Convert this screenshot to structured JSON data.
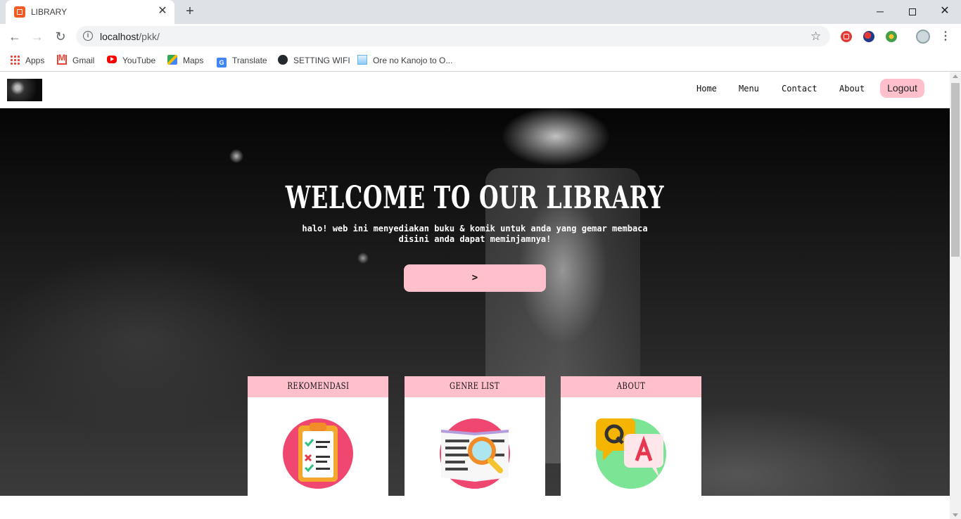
{
  "browser": {
    "tab_title": "LIBRARY",
    "tab_close": "✕",
    "new_tab": "+",
    "url_host": "localhost",
    "url_path": "/pkk/",
    "window": {
      "minimize": "─",
      "close": "✕"
    },
    "bookmarks": [
      {
        "label": "Apps",
        "icon": "apps-icon"
      },
      {
        "label": "Gmail",
        "icon": "gmail-icon"
      },
      {
        "label": "YouTube",
        "icon": "youtube-icon"
      },
      {
        "label": "Maps",
        "icon": "maps-icon"
      },
      {
        "label": "Translate",
        "icon": "translate-icon"
      },
      {
        "label": "SETTING WIFI",
        "icon": "github-icon"
      },
      {
        "label": "Ore no Kanojo to O...",
        "icon": "page-icon"
      }
    ]
  },
  "site": {
    "nav": {
      "home": "Home",
      "menu": "Menu",
      "contact": "Contact",
      "about": "About",
      "logout": "Logout"
    },
    "hero": {
      "title": "WELCOME TO OUR LIBRARY",
      "subtitle_line1": "halo! web ini menyediakan buku & komik untuk anda yang gemar membaca",
      "subtitle_line2": "disini anda dapat meminjamnya!",
      "button": ">"
    },
    "cards": [
      {
        "title": "REKOMENDASI",
        "icon": "checklist-icon"
      },
      {
        "title": "GENRE LIST",
        "icon": "book-search-icon"
      },
      {
        "title": "ABOUT",
        "icon": "qa-icon"
      }
    ]
  },
  "colors": {
    "accent_pink": "#ffc0cb",
    "tab_strip": "#dee1e6"
  }
}
